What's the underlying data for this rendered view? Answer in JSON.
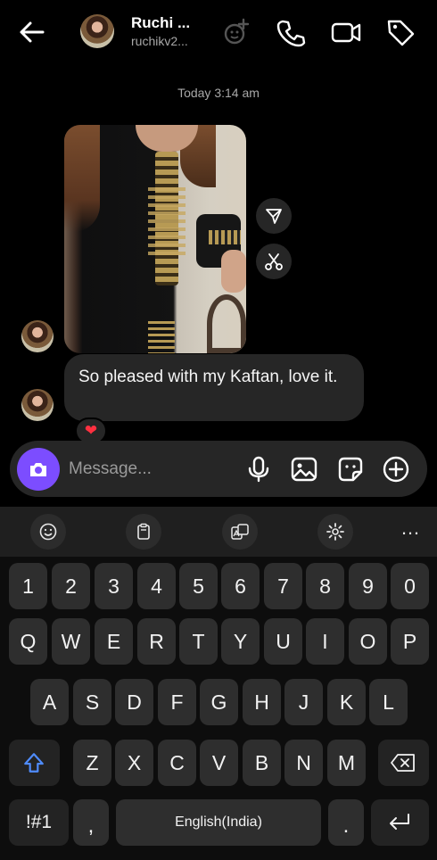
{
  "header": {
    "contact_name": "Ruchi ...",
    "username": "ruchikv2...",
    "icons": [
      "back-arrow-icon",
      "add-people-icon",
      "phone-icon",
      "video-call-icon",
      "tag-icon"
    ]
  },
  "thread": {
    "timestamp": "Today 3:14 am",
    "message_text": "So pleased with my Kaftan, love it.",
    "reaction": "❤"
  },
  "composer": {
    "placeholder": "Message...",
    "icons": [
      "camera-icon",
      "microphone-icon",
      "gallery-icon",
      "sticker-icon",
      "add-icon"
    ],
    "accent_color": "#7c4dff"
  },
  "keyboard": {
    "toolbar_more": "…",
    "row_numbers": [
      "1",
      "2",
      "3",
      "4",
      "5",
      "6",
      "7",
      "8",
      "9",
      "0"
    ],
    "row_1": [
      "Q",
      "W",
      "E",
      "R",
      "T",
      "Y",
      "U",
      "I",
      "O",
      "P"
    ],
    "row_2": [
      "A",
      "S",
      "D",
      "F",
      "G",
      "H",
      "J",
      "K",
      "L"
    ],
    "row_3": [
      "Z",
      "X",
      "C",
      "V",
      "B",
      "N",
      "M"
    ],
    "symbols_label": "!#1",
    "comma_label": ",",
    "space_label": "English(India)",
    "period_label": ".",
    "shift_color": "#4f8cff"
  }
}
